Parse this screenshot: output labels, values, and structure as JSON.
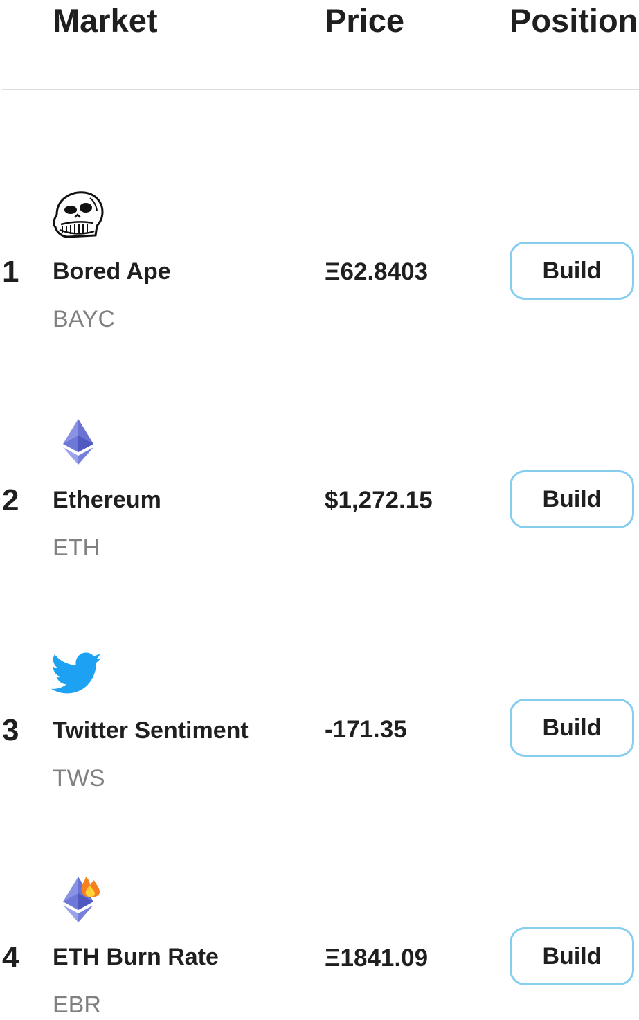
{
  "table": {
    "headers": {
      "market": "Market",
      "price": "Price",
      "position": "Position"
    },
    "rows": [
      {
        "rank": "1",
        "name": "Bored Ape",
        "ticker": "BAYC",
        "price": "Ξ62.8403",
        "button_label": "Build",
        "icon": "bored-ape-skull-icon"
      },
      {
        "rank": "2",
        "name": "Ethereum",
        "ticker": "ETH",
        "price": "$1,272.15",
        "button_label": "Build",
        "icon": "ethereum-icon"
      },
      {
        "rank": "3",
        "name": "Twitter Sentiment",
        "ticker": "TWS",
        "price": "-171.35",
        "button_label": "Build",
        "icon": "twitter-bird-icon"
      },
      {
        "rank": "4",
        "name": "ETH Burn Rate",
        "ticker": "EBR",
        "price": "Ξ1841.09",
        "button_label": "Build",
        "icon": "ethereum-fire-icon"
      }
    ]
  },
  "colors": {
    "text": "#1f1f1f",
    "muted": "#808080",
    "button_border": "#86cdf0",
    "divider": "#dcdcdc",
    "twitter_blue": "#1da1f2",
    "eth_purple": "#6f7ad8"
  }
}
